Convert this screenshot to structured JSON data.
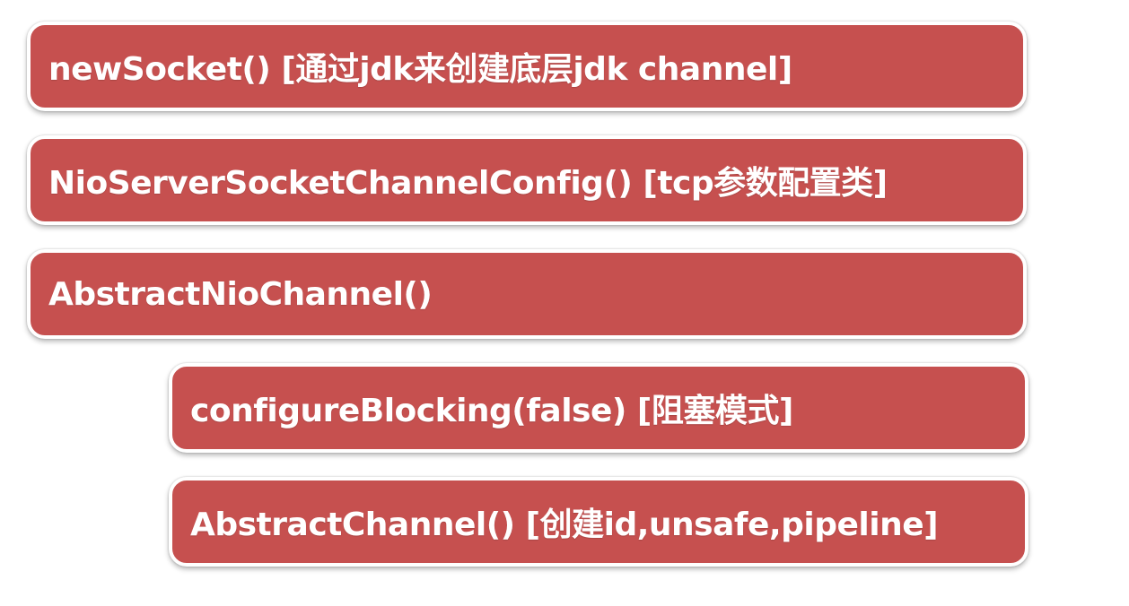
{
  "steps": [
    {
      "label": "newSocket() [通过jdk来创建底层jdk channel]"
    },
    {
      "label": "NioServerSocketChannelConfig() [tcp参数配置类]"
    },
    {
      "label": "AbstractNioChannel()"
    },
    {
      "label": "configureBlocking(false) [阻塞模式]"
    },
    {
      "label": "AbstractChannel() [创建id,unsafe,pipeline]"
    }
  ],
  "colors": {
    "box_fill": "#c6504f",
    "box_border": "#ffffff",
    "text": "#ffffff",
    "background": "#ffffff"
  }
}
